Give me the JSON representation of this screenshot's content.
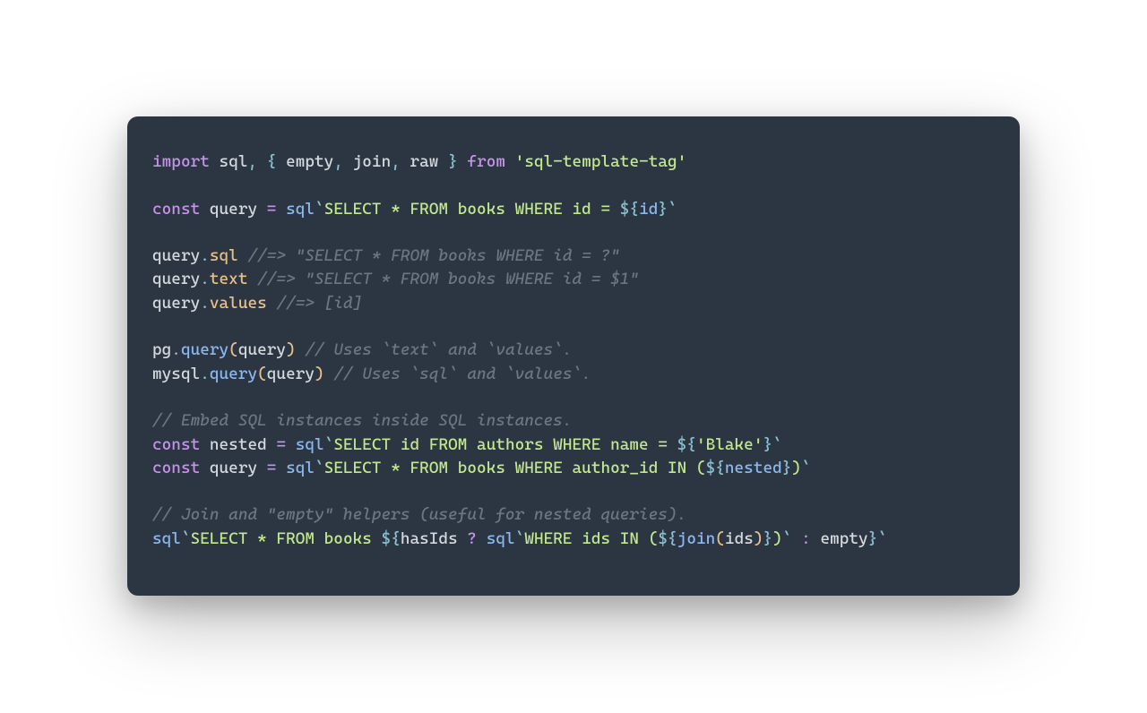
{
  "l1": {
    "import": "import",
    "sql": "sql",
    "c1": ", ",
    "lb": "{ ",
    "empty": "empty",
    "c2": ", ",
    "join": "join",
    "c3": ", ",
    "raw": "raw",
    "rb": " }",
    "sp": " ",
    "from": "from",
    "sp2": " ",
    "q1": "'",
    "pkg": "sql-template-tag",
    "q2": "'"
  },
  "l3": {
    "const": "const",
    "sp": " ",
    "query": "query",
    "sp2": " ",
    "eq": "=",
    "sp3": " ",
    "sql": "sql",
    "bt1": "`",
    "tpl": "SELECT * FROM books WHERE id = ",
    "d1": "${",
    "id": "id",
    "d2": "}",
    "bt2": "`"
  },
  "l5": {
    "p1": "query",
    "dot": ".",
    "p2": "sql",
    "sp": " ",
    "cmt": "//=> \"SELECT * FROM books WHERE id = ?\""
  },
  "l6": {
    "p1": "query",
    "dot": ".",
    "p2": "text",
    "sp": " ",
    "cmt": "//=> \"SELECT * FROM books WHERE id = $1\""
  },
  "l7": {
    "p1": "query",
    "dot": ".",
    "p2": "values",
    "sp": " ",
    "cmt": "//=> [id]"
  },
  "l9": {
    "pg": "pg",
    "dot": ".",
    "call": "query",
    "lp": "(",
    "arg": "query",
    "rp": ")",
    "sp": " ",
    "cmt": "// Uses `text` and `values`."
  },
  "l10": {
    "mysql": "mysql",
    "dot": ".",
    "call": "query",
    "lp": "(",
    "arg": "query",
    "rp": ")",
    "sp": " ",
    "cmt": "// Uses `sql` and `values`."
  },
  "l12": {
    "cmt": "// Embed SQL instances inside SQL instances."
  },
  "l13": {
    "const": "const",
    "sp": " ",
    "name": "nested",
    "sp2": " ",
    "eq": "=",
    "sp3": " ",
    "sql": "sql",
    "bt1": "`",
    "tpl": "SELECT id FROM authors WHERE name = ",
    "d1": "${",
    "lit": "'Blake'",
    "d2": "}",
    "bt2": "`"
  },
  "l14": {
    "const": "const",
    "sp": " ",
    "name": "query",
    "sp2": " ",
    "eq": "=",
    "sp3": " ",
    "sql": "sql",
    "bt1": "`",
    "tpl": "SELECT * FROM books WHERE author_id IN (",
    "d1": "${",
    "var": "nested",
    "d2": "}",
    "tpl2": ")",
    "bt2": "`"
  },
  "l16": {
    "cmt": "// Join and \"empty\" helpers (useful for nested queries)."
  },
  "l17": {
    "sql": "sql",
    "bt1": "`",
    "tpl": "SELECT * FROM books ",
    "d1": "${",
    "hasIds": "hasIds",
    "sp": " ",
    "q": "?",
    "sp2": " ",
    "sql2": "sql",
    "bt2": "`",
    "tpl2": "WHERE ids IN (",
    "d2": "${",
    "join": "join",
    "lp": "(",
    "ids": "ids",
    "rp": ")",
    "d3": "}",
    "tpl3": ")",
    "bt3": "`",
    "sp3": " ",
    "colon": ":",
    "sp4": " ",
    "empty": "empty",
    "d4": "}",
    "bt4": "`"
  }
}
